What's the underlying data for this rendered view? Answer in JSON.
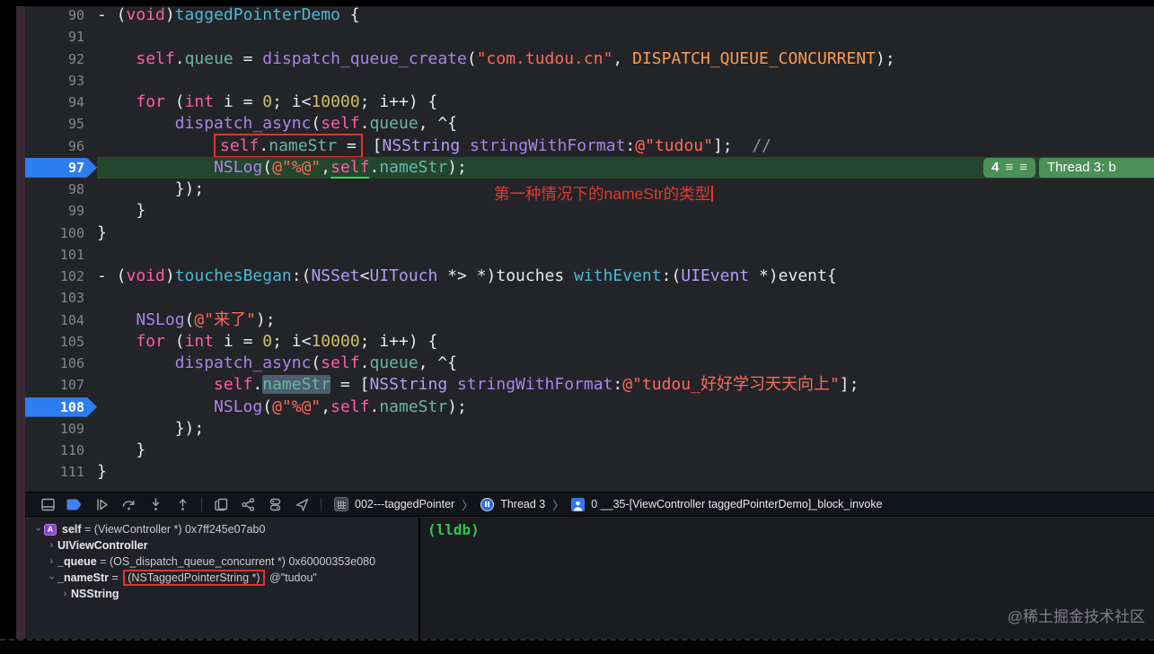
{
  "colors": {
    "accent_blue": "#2e7df0",
    "exec_line_green": "#25462e",
    "badge_green": "#4b9157",
    "red_box": "#e1342b",
    "annotation_red": "#e03a2f",
    "lldb_green": "#35c451",
    "selection_gray_blue": "#4b5d6e"
  },
  "icons": {
    "hamburger": "≡",
    "jump_chevron": "〉",
    "chevron": "›"
  },
  "editor": {
    "annotation": {
      "text": "第一种情况下的nameStr的类型"
    },
    "exec_badges": {
      "count": "4",
      "thread": "Thread 3: b"
    },
    "lines": [
      {
        "num": "90",
        "tokens": [
          [
            "w",
            "- ("
          ],
          [
            "k",
            "void"
          ],
          [
            "w",
            ")"
          ],
          [
            "m",
            "taggedPointerDemo"
          ],
          [
            "w",
            " {"
          ]
        ]
      },
      {
        "num": "91",
        "tokens": []
      },
      {
        "num": "92",
        "tokens": [
          [
            "w",
            "    "
          ],
          [
            "k",
            "self"
          ],
          [
            "w",
            "."
          ],
          [
            "p",
            "queue"
          ],
          [
            "w",
            " = "
          ],
          [
            "f",
            "dispatch_queue_create"
          ],
          [
            "w",
            "("
          ],
          [
            "s",
            "\"com.tudou.cn\""
          ],
          [
            "w",
            ", "
          ],
          [
            "o",
            "DISPATCH_QUEUE_CONCURRENT"
          ],
          [
            "w",
            ");"
          ]
        ]
      },
      {
        "num": "93",
        "tokens": []
      },
      {
        "num": "94",
        "tokens": [
          [
            "w",
            "    "
          ],
          [
            "k",
            "for"
          ],
          [
            "w",
            " ("
          ],
          [
            "k",
            "int"
          ],
          [
            "w",
            " i = "
          ],
          [
            "n",
            "0"
          ],
          [
            "w",
            "; i<"
          ],
          [
            "n",
            "10000"
          ],
          [
            "w",
            "; i++) {"
          ]
        ]
      },
      {
        "num": "95",
        "tokens": [
          [
            "w",
            "        "
          ],
          [
            "f",
            "dispatch_async"
          ],
          [
            "w",
            "("
          ],
          [
            "k",
            "self"
          ],
          [
            "w",
            "."
          ],
          [
            "p",
            "queue"
          ],
          [
            "w",
            ", ^{"
          ]
        ]
      },
      {
        "num": "96",
        "tokens": [
          [
            "w",
            "            "
          ],
          [
            "k",
            "self",
            "box"
          ],
          [
            "w",
            ".",
            "box"
          ],
          [
            "p",
            "nameStr",
            "box"
          ],
          [
            "w",
            " =",
            "box"
          ],
          [
            "w",
            " ["
          ],
          [
            "t",
            "NSString"
          ],
          [
            "w",
            " "
          ],
          [
            "f",
            "stringWithFormat"
          ],
          [
            "w",
            ":"
          ],
          [
            "s",
            "@\"tudou\""
          ],
          [
            "w",
            "];  "
          ],
          [
            "c",
            "//"
          ]
        ]
      },
      {
        "num": "97",
        "exec": true,
        "bp": true,
        "tokens": [
          [
            "w",
            "            "
          ],
          [
            "f",
            "NSLog"
          ],
          [
            "w",
            "("
          ],
          [
            "s",
            "@\"%@\""
          ],
          [
            "w",
            ","
          ],
          [
            "k",
            "self",
            "u"
          ],
          [
            "w",
            "."
          ],
          [
            "p",
            "nameStr"
          ],
          [
            "w",
            ");"
          ]
        ]
      },
      {
        "num": "98",
        "tokens": [
          [
            "w",
            "        });"
          ]
        ]
      },
      {
        "num": "99",
        "tokens": [
          [
            "w",
            "    }"
          ]
        ]
      },
      {
        "num": "100",
        "tokens": [
          [
            "w",
            "}"
          ]
        ]
      },
      {
        "num": "101",
        "tokens": []
      },
      {
        "num": "102",
        "tokens": [
          [
            "w",
            "- ("
          ],
          [
            "k",
            "void"
          ],
          [
            "w",
            ")"
          ],
          [
            "m",
            "touchesBegan"
          ],
          [
            "w",
            ":("
          ],
          [
            "t",
            "NSSet"
          ],
          [
            "w",
            "<"
          ],
          [
            "t",
            "UITouch"
          ],
          [
            "w",
            " *> *)touches "
          ],
          [
            "m",
            "withEvent"
          ],
          [
            "w",
            ":("
          ],
          [
            "t",
            "UIEvent"
          ],
          [
            "w",
            " *)event{"
          ]
        ]
      },
      {
        "num": "103",
        "tokens": []
      },
      {
        "num": "104",
        "tokens": [
          [
            "w",
            "    "
          ],
          [
            "f",
            "NSLog"
          ],
          [
            "w",
            "("
          ],
          [
            "s",
            "@\"来了\""
          ],
          [
            "w",
            ");"
          ]
        ]
      },
      {
        "num": "105",
        "tokens": [
          [
            "w",
            "    "
          ],
          [
            "k",
            "for"
          ],
          [
            "w",
            " ("
          ],
          [
            "k",
            "int"
          ],
          [
            "w",
            " i = "
          ],
          [
            "n",
            "0"
          ],
          [
            "w",
            "; i<"
          ],
          [
            "n",
            "10000"
          ],
          [
            "w",
            "; i++) {"
          ]
        ]
      },
      {
        "num": "106",
        "tokens": [
          [
            "w",
            "        "
          ],
          [
            "f",
            "dispatch_async"
          ],
          [
            "w",
            "("
          ],
          [
            "k",
            "self"
          ],
          [
            "w",
            "."
          ],
          [
            "p",
            "queue"
          ],
          [
            "w",
            ", ^{"
          ]
        ]
      },
      {
        "num": "107",
        "tokens": [
          [
            "w",
            "            "
          ],
          [
            "k",
            "self"
          ],
          [
            "w",
            "."
          ],
          [
            "p",
            "nameStr",
            "sel"
          ],
          [
            "w",
            " = ["
          ],
          [
            "t",
            "NSString"
          ],
          [
            "w",
            " "
          ],
          [
            "f",
            "stringWithFormat"
          ],
          [
            "w",
            ":"
          ],
          [
            "s",
            "@\"tudou_好好学习天天向上\""
          ],
          [
            "w",
            "];"
          ]
        ]
      },
      {
        "num": "108",
        "bp": true,
        "tokens": [
          [
            "w",
            "            "
          ],
          [
            "f",
            "NSLog"
          ],
          [
            "w",
            "("
          ],
          [
            "s",
            "@\"%@\""
          ],
          [
            "w",
            ","
          ],
          [
            "k",
            "self"
          ],
          [
            "w",
            "."
          ],
          [
            "p",
            "nameStr"
          ],
          [
            "w",
            ");"
          ]
        ]
      },
      {
        "num": "109",
        "tokens": [
          [
            "w",
            "        });"
          ]
        ]
      },
      {
        "num": "110",
        "tokens": [
          [
            "w",
            "    }"
          ]
        ]
      },
      {
        "num": "111",
        "tokens": [
          [
            "w",
            "}"
          ]
        ]
      }
    ]
  },
  "debug_bar": {
    "process_label": "002---taggedPointer",
    "thread_label": "Thread 3",
    "frame_label": "0 __35-[ViewController taggedPointerDemo]_block_invoke"
  },
  "variables": {
    "rows": [
      {
        "depth": 0,
        "expanded": true,
        "badge": "A",
        "name": "self",
        "rest": " = (ViewController *) 0x7ff245e07ab0"
      },
      {
        "depth": 1,
        "expanded": false,
        "name": "UIViewController",
        "rest": ""
      },
      {
        "depth": 1,
        "expanded": false,
        "name": "_queue",
        "rest": " = (OS_dispatch_queue_concurrent *) 0x60000353e080"
      },
      {
        "depth": 1,
        "expanded": true,
        "name": "_nameStr",
        "rest_pre": " = ",
        "boxed": "(NSTaggedPointerString *)",
        "rest_post": " @\"tudou\""
      },
      {
        "depth": 2,
        "expanded": false,
        "name": "NSString",
        "rest": ""
      }
    ]
  },
  "console": {
    "prompt": "(lldb)"
  },
  "watermark": "@稀土掘金技术社区"
}
